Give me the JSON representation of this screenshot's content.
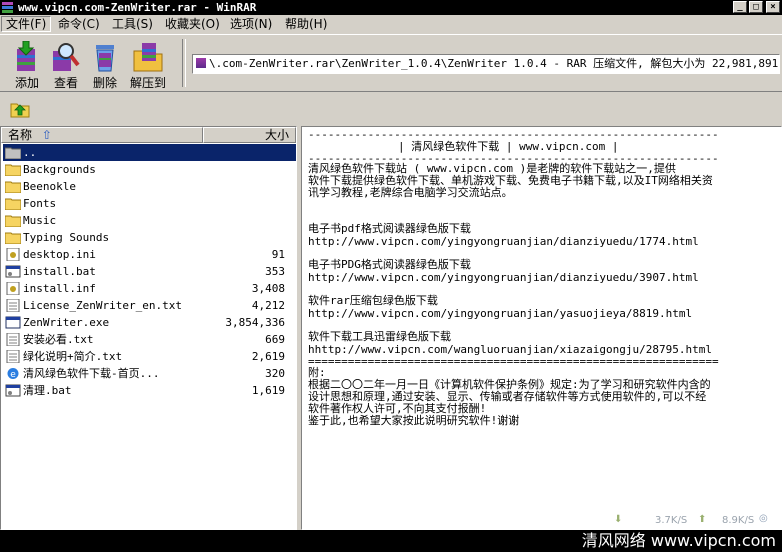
{
  "window": {
    "title": "www.vipcn.com-ZenWriter.rar - WinRAR"
  },
  "menu": {
    "items": [
      {
        "label": "文件(F)"
      },
      {
        "label": "命令(C)"
      },
      {
        "label": "工具(S)"
      },
      {
        "label": "收藏夹(O)"
      },
      {
        "label": "选项(N)"
      },
      {
        "label": "帮助(H)"
      }
    ]
  },
  "toolbar": {
    "add_label": "添加",
    "view_label": "查看",
    "delete_label": "删除",
    "extract_label": "解压到"
  },
  "path": {
    "text": "\\.com-ZenWriter.rar\\ZenWriter_1.0.4\\ZenWriter 1.0.4 - RAR 压缩文件, 解包大小为 22,981,891 字节"
  },
  "columns": {
    "name": "名称",
    "size": "大小"
  },
  "files": [
    {
      "name": "..",
      "size": "",
      "icon": "folder-up-icon",
      "selected": true
    },
    {
      "name": "Backgrounds",
      "size": "",
      "icon": "folder-icon"
    },
    {
      "name": "Beenokle",
      "size": "",
      "icon": "folder-icon"
    },
    {
      "name": "Fonts",
      "size": "",
      "icon": "folder-icon"
    },
    {
      "name": "Music",
      "size": "",
      "icon": "folder-icon"
    },
    {
      "name": "Typing Sounds",
      "size": "",
      "icon": "folder-icon"
    },
    {
      "name": "desktop.ini",
      "size": "91",
      "icon": "settings-file-icon"
    },
    {
      "name": "install.bat",
      "size": "353",
      "icon": "batch-file-icon"
    },
    {
      "name": "install.inf",
      "size": "3,408",
      "icon": "settings-file-icon"
    },
    {
      "name": "License_ZenWriter_en.txt",
      "size": "4,212",
      "icon": "text-file-icon"
    },
    {
      "name": "ZenWriter.exe",
      "size": "3,854,336",
      "icon": "exe-file-icon"
    },
    {
      "name": "安装必看.txt",
      "size": "669",
      "icon": "text-file-icon"
    },
    {
      "name": "绿化说明+简介.txt",
      "size": "2,619",
      "icon": "text-file-icon"
    },
    {
      "name": "清风绿色软件下载-首页...",
      "size": "320",
      "icon": "ie-link-icon"
    },
    {
      "name": "清理.bat",
      "size": "1,619",
      "icon": "batch-file-icon"
    }
  ],
  "comment": {
    "rule1": "--------------------------------------------------------------",
    "header": "| 清风绿色软件下载 | www.vipcn.com |",
    "rule2": "--------------------------------------------------------------",
    "intro1": "        清风绿色软件下载站 ( www.vipcn.com )是老牌的软件下载站之一,提供",
    "intro2": "软件下载提供绿色软件下载、单机游戏下载、免费电子书籍下载,以及IT网络相关资",
    "intro3": "讯学习教程,老牌综合电脑学习交流站点。",
    "item1_title": "电子书pdf格式阅读器绿色版下载",
    "item1_url": "http://www.vipcn.com/yingyongruanjian/dianziyuedu/1774.html",
    "item2_title": "电子书PDG格式阅读器绿色版下载",
    "item2_url": "http://www.vipcn.com/yingyongruanjian/dianziyuedu/3907.html",
    "item3_title": "软件rar压缩包绿色版下载",
    "item3_url": "http://www.vipcn.com/yingyongruanjian/yasuojieya/8819.html",
    "item4_title": "软件下载工具迅雷绿色版下载",
    "item4_url": "hhttp://www.vipcn.com/wangluoruanjian/xiazaigongju/28795.html",
    "rule3": "==============================================================",
    "note_label": "附:",
    "note1": "根据二〇〇二年一月一日《计算机软件保护条例》规定:为了学习和研究软件内含的",
    "note2": "设计思想和原理,通过安装、显示、传输或者存储软件等方式使用软件的,可以不经",
    "note3": "软件著作权人许可,不向其支付报酬!",
    "note4": "鉴于此,也希望大家按此说明研究软件!谢谢"
  },
  "speed": {
    "down": "3.7K/S",
    "up": "8.9K/S"
  },
  "watermark": "清风网络 www.vipcn.com"
}
